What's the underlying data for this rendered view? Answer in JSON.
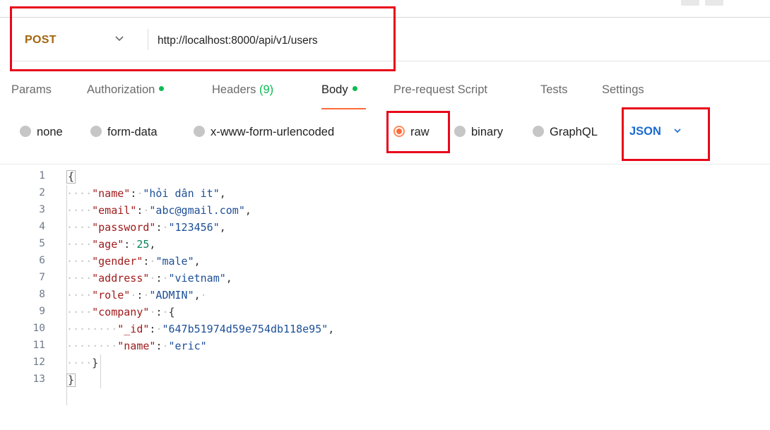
{
  "request": {
    "method": "POST",
    "url": "http://localhost:8000/api/v1/users"
  },
  "tabs": [
    {
      "label": "Params"
    },
    {
      "label": "Authorization"
    },
    {
      "label": "Headers",
      "count": "(9)"
    },
    {
      "label": "Body"
    },
    {
      "label": "Pre-request Script"
    },
    {
      "label": "Tests"
    },
    {
      "label": "Settings"
    }
  ],
  "body_types": [
    "none",
    "form-data",
    "x-www-form-urlencoded",
    "raw",
    "binary",
    "GraphQL"
  ],
  "selected_body_type": "raw",
  "language": "JSON",
  "colors": {
    "method": "#a3650c",
    "accent": "#ff6c37",
    "indicator": "#0cbb52",
    "language": "#1b6ad0",
    "annotation": "#e8081a",
    "json_key": "#a01b1b",
    "json_string": "#1c4f97",
    "json_number": "#098658"
  },
  "editor": {
    "line_numbers": [
      "1",
      "2",
      "3",
      "4",
      "5",
      "6",
      "7",
      "8",
      "9",
      "10",
      "11",
      "12",
      "13"
    ],
    "lines": [
      {
        "open": "{"
      },
      {
        "key": "\"name\"",
        "sep": ":",
        "str": "\"hỏi dân it\"",
        "end": ","
      },
      {
        "key": "\"email\"",
        "sep": ":",
        "str": "\"abc@gmail.com\"",
        "end": ","
      },
      {
        "key": "\"password\"",
        "sep": ":",
        "str": "\"123456\"",
        "end": ","
      },
      {
        "key": "\"age\"",
        "sep": ":",
        "num": "25",
        "end": ","
      },
      {
        "key": "\"gender\"",
        "sep": ":",
        "str": "\"male\"",
        "end": ","
      },
      {
        "key": "\"address\"",
        "sep": ":",
        "str": "\"vietnam\"",
        "end": ","
      },
      {
        "key": "\"role\"",
        "sep": ":",
        "str": "\"ADMIN\"",
        "end": ","
      },
      {
        "key": "\"company\"",
        "sep": ":",
        "open": "{"
      },
      {
        "key": "\"_id\"",
        "sep": ":",
        "str": "\"647b51974d59e754db118e95\"",
        "end": ","
      },
      {
        "key": "\"name\"",
        "sep": ":",
        "str": "\"eric\""
      },
      {
        "close": "}"
      },
      {
        "close": "}"
      }
    ]
  }
}
